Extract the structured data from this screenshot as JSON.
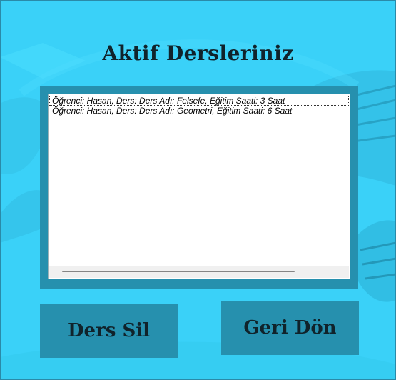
{
  "window": {
    "title": "Aktif Dersleriniz"
  },
  "course_list": {
    "items": [
      "Öğrenci: Hasan, Ders: Ders Adı: Felsefe, Eğitim Saati: 3 Saat",
      "Öğrenci: Hasan, Ders: Ders Adı: Geometri, Eğitim Saati: 6 Saat"
    ],
    "selected_index": 0
  },
  "buttons": {
    "delete_label": "Ders Sil",
    "back_label": "Geri Dön"
  },
  "colors": {
    "background": "#3ad1f8",
    "panel": "#2690ae",
    "text": "#10232b"
  }
}
